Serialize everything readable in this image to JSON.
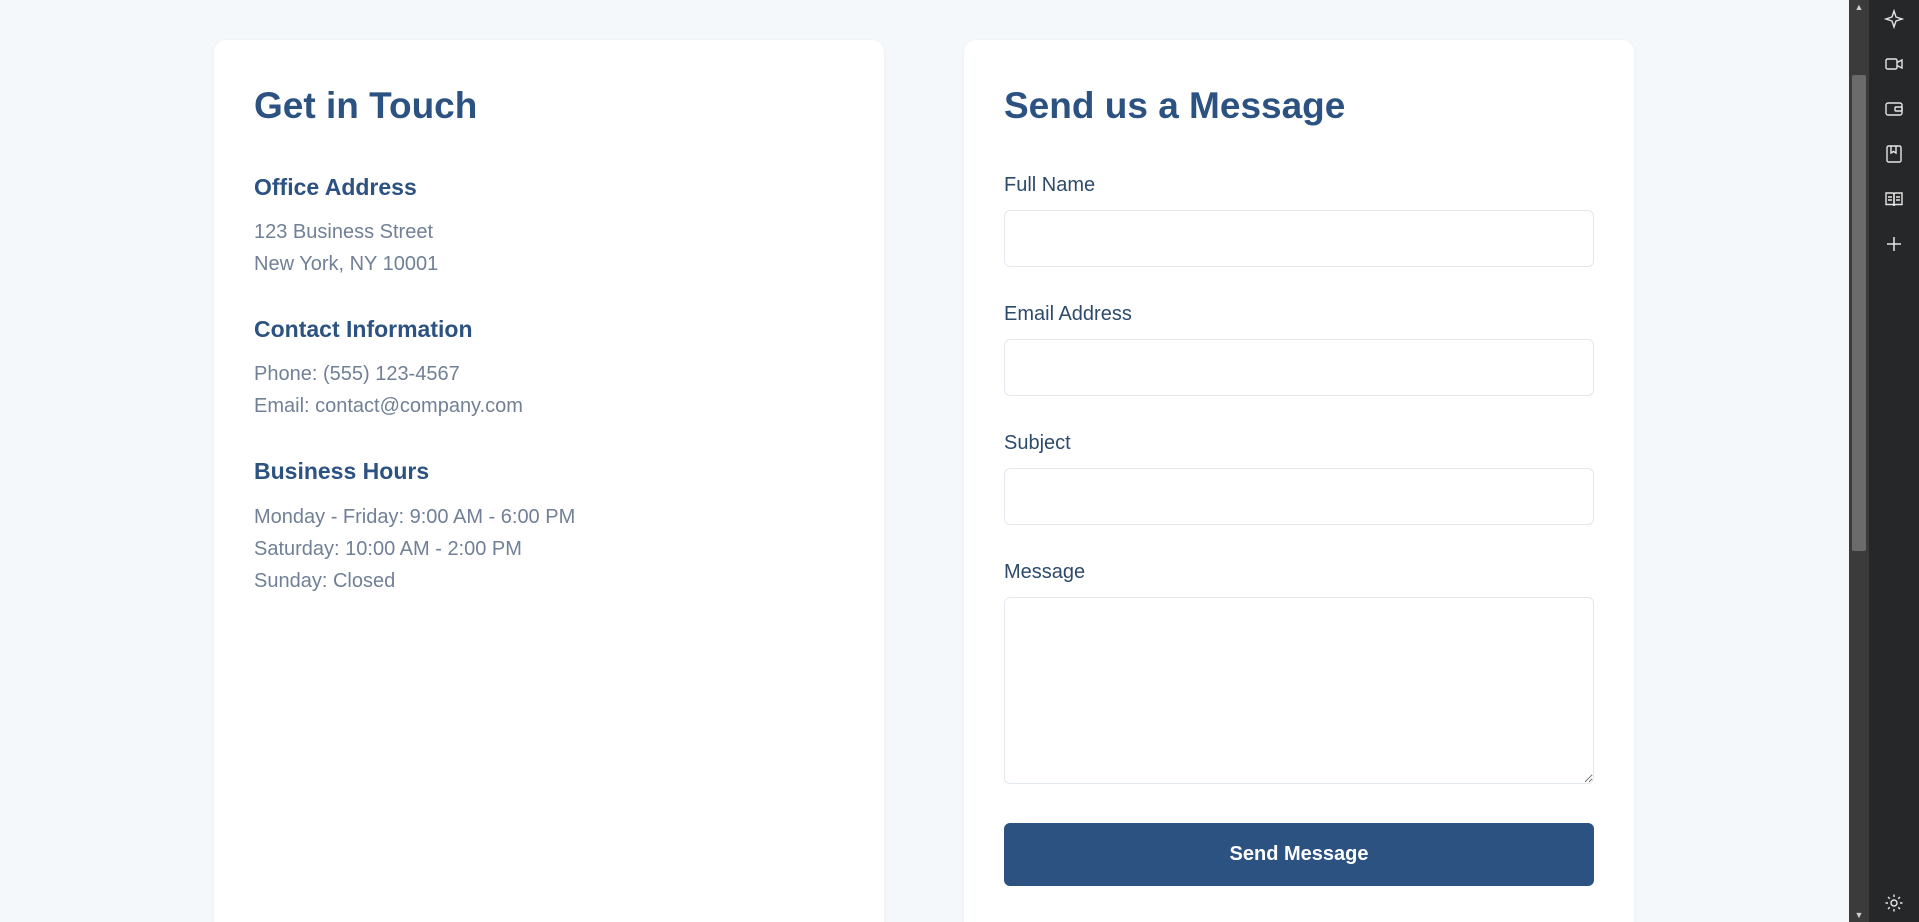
{
  "info_card": {
    "title": "Get in Touch",
    "office": {
      "heading": "Office Address",
      "lines": [
        "123 Business Street",
        "New York, NY 10001"
      ]
    },
    "contact": {
      "heading": "Contact Information",
      "phone": "Phone: (555) 123-4567",
      "email": "Email: contact@company.com"
    },
    "hours": {
      "heading": "Business Hours",
      "lines": [
        "Monday - Friday: 9:00 AM - 6:00 PM",
        "Saturday: 10:00 AM - 2:00 PM",
        "Sunday: Closed"
      ]
    }
  },
  "form_card": {
    "title": "Send us a Message",
    "fields": {
      "name": {
        "label": "Full Name",
        "value": ""
      },
      "email": {
        "label": "Email Address",
        "value": ""
      },
      "subject": {
        "label": "Subject",
        "value": ""
      },
      "message": {
        "label": "Message",
        "value": ""
      }
    },
    "submit_label": "Send Message"
  },
  "side_panel": {
    "icons": [
      "sparkle-icon",
      "video-icon",
      "wallet-icon",
      "bookmark-icon",
      "reader-icon",
      "plus-icon",
      "settings-icon"
    ]
  },
  "colors": {
    "accent": "#2c5282",
    "page_background": "#f5f8fb",
    "muted_text": "#718096"
  }
}
